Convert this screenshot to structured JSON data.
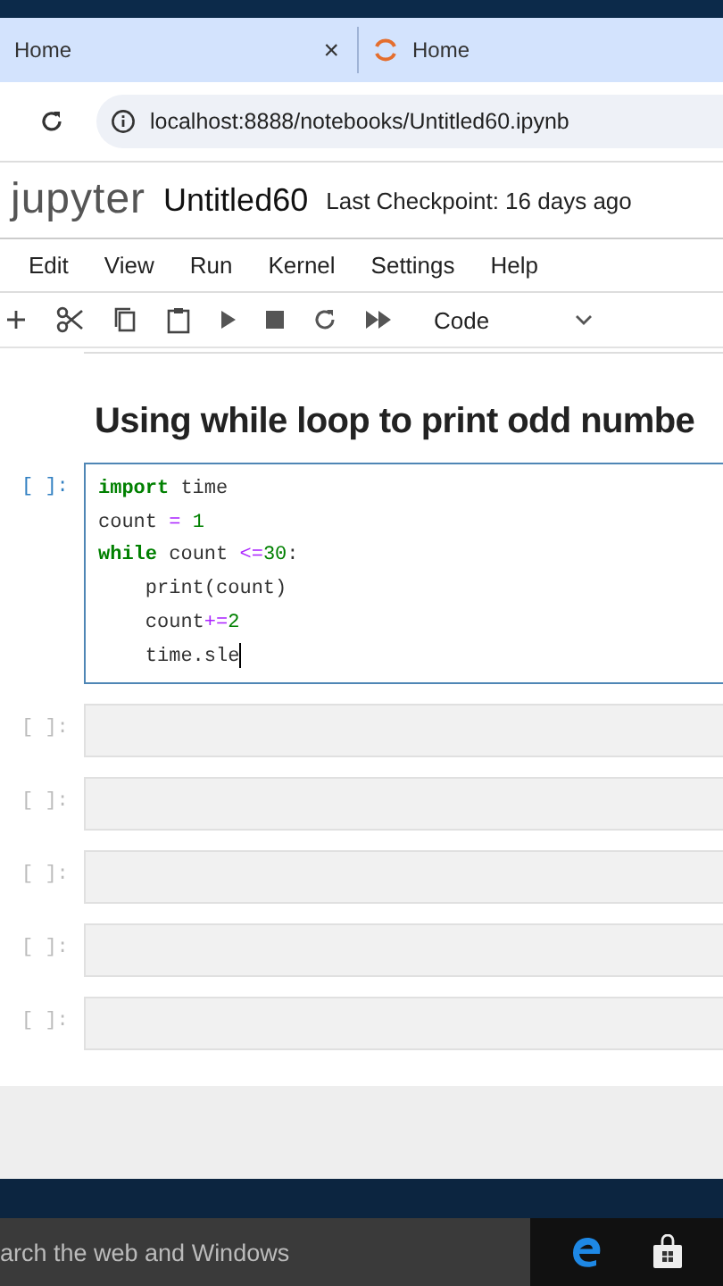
{
  "browser": {
    "tabs": [
      {
        "title": "Home",
        "close": "×",
        "loading": false
      },
      {
        "title": "Home",
        "loading": true
      }
    ],
    "url": "localhost:8888/notebooks/Untitled60.ipynb"
  },
  "header": {
    "logo": "jupyter",
    "notebook_title": "Untitled60",
    "checkpoint": "Last Checkpoint: 16 days ago"
  },
  "menu": [
    "Edit",
    "View",
    "Run",
    "Kernel",
    "Settings",
    "Help"
  ],
  "toolbar": {
    "cell_type": "Code"
  },
  "cells": [
    {
      "kind": "markdown",
      "text": "Using while loop to print odd numbe"
    },
    {
      "kind": "code",
      "prompt": "[ ]:",
      "active": true,
      "lines": [
        [
          {
            "t": "import",
            "kind": "keyword"
          },
          {
            "t": " time",
            "kind": "name"
          }
        ],
        [
          {
            "t": "count ",
            "kind": "name"
          },
          {
            "t": "=",
            "kind": "operator"
          },
          {
            "t": " 1",
            "kind": "number"
          }
        ],
        [
          {
            "t": "while",
            "kind": "keyword"
          },
          {
            "t": " count ",
            "kind": "name"
          },
          {
            "t": "<=",
            "kind": "operator"
          },
          {
            "t": "30",
            "kind": "number"
          },
          {
            "t": ":",
            "kind": "name"
          }
        ],
        [
          {
            "t": "    print(count)",
            "kind": "name"
          }
        ],
        [
          {
            "t": "    count",
            "kind": "name"
          },
          {
            "t": "+=",
            "kind": "operator"
          },
          {
            "t": "2",
            "kind": "number"
          }
        ],
        [
          {
            "t": "    time.sle",
            "kind": "name"
          }
        ]
      ]
    },
    {
      "kind": "code",
      "prompt": "[ ]:",
      "active": false
    },
    {
      "kind": "code",
      "prompt": "[ ]:",
      "active": false
    },
    {
      "kind": "code",
      "prompt": "[ ]:",
      "active": false
    },
    {
      "kind": "code",
      "prompt": "[ ]:",
      "active": false
    },
    {
      "kind": "code",
      "prompt": "[ ]:",
      "active": false
    }
  ],
  "taskbar": {
    "search_placeholder": "arch the web and Windows"
  }
}
